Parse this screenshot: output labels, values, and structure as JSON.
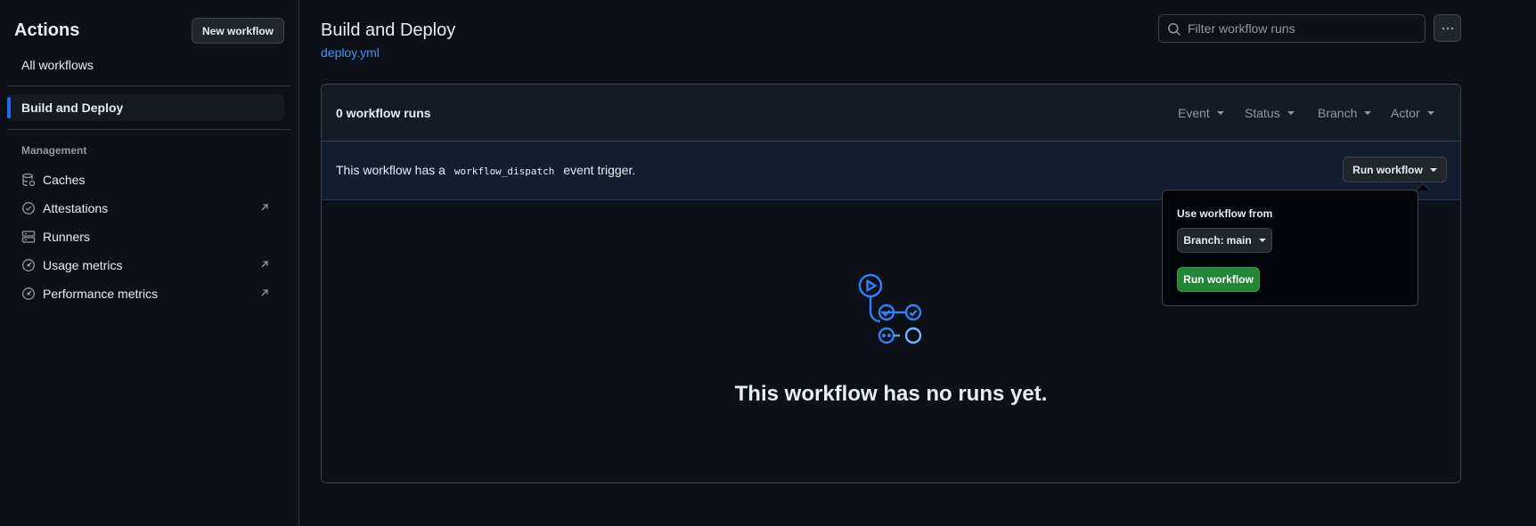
{
  "sidebar": {
    "title": "Actions",
    "new_workflow_label": "New workflow",
    "all_workflows_label": "All workflows",
    "active_workflow_label": "Build and Deploy",
    "section_title": "Management",
    "items": [
      {
        "label": "Caches",
        "icon": "database-icon",
        "external": false
      },
      {
        "label": "Attestations",
        "icon": "verified-icon",
        "external": true
      },
      {
        "label": "Runners",
        "icon": "server-icon",
        "external": false
      },
      {
        "label": "Usage metrics",
        "icon": "meter-icon",
        "external": true
      },
      {
        "label": "Performance metrics",
        "icon": "meter-icon",
        "external": true
      }
    ]
  },
  "header": {
    "title": "Build and Deploy",
    "file_link": "deploy.yml",
    "search_placeholder": "Filter workflow runs",
    "more_icon": "kebab-horizontal-icon"
  },
  "runs": {
    "count_label": "0 workflow runs",
    "filters": [
      "Event",
      "Status",
      "Branch",
      "Actor"
    ]
  },
  "banner": {
    "text_before": "This workflow has a",
    "code": "workflow_dispatch",
    "text_after": "event trigger.",
    "run_button_label": "Run workflow"
  },
  "empty_state": {
    "icon": "workflow-icon",
    "message": "This workflow has no runs yet."
  },
  "popover": {
    "label": "Use workflow from",
    "branch_prefix": "Branch:",
    "branch_value": "main",
    "run_button_label": "Run workflow"
  },
  "colors": {
    "background": "#0d1117",
    "accent": "#1f6feb",
    "link": "#4493f8",
    "success": "#238636",
    "border": "#3d444d"
  }
}
